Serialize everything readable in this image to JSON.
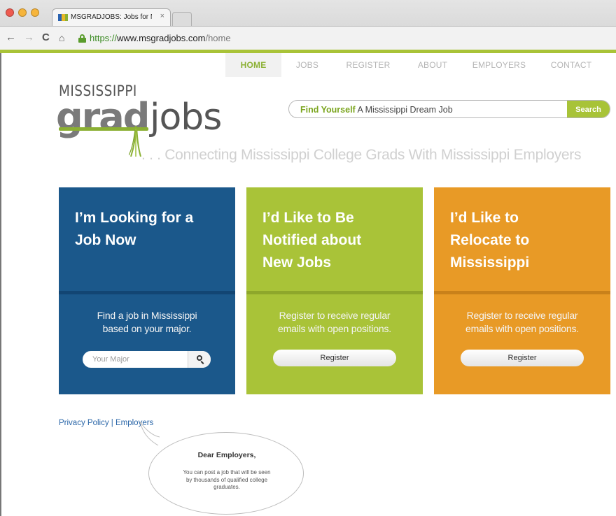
{
  "browser": {
    "tab_title": "MSGRADJOBS: Jobs for Mis",
    "tab_close": "×",
    "url_scheme": "https://",
    "url_host": "www.msgradjobs.com",
    "url_path": "/home",
    "icons": [
      "back-arrow",
      "forward-arrow",
      "reload",
      "home",
      "lock"
    ]
  },
  "nav": {
    "items": [
      {
        "label": "HOME"
      },
      {
        "label": "JOBS"
      },
      {
        "label": "REGISTER"
      },
      {
        "label": "ABOUT"
      },
      {
        "label": "EMPLOYERS"
      },
      {
        "label": "CONTACT"
      }
    ]
  },
  "logo": {
    "top": "MISSISSIPPI",
    "grad": "grad",
    "jobs": "jobs"
  },
  "search": {
    "highlight": "Find Yourself",
    "text": "A Mississippi Dream Job",
    "button": "Search"
  },
  "tagline": ". . . Connecting Mississippi College Grads With Mississippi Employers",
  "cards": [
    {
      "heading": [
        "I’m Looking for a",
        "Job Now"
      ],
      "desc": [
        "Find a job in Mississippi",
        "based on your major."
      ],
      "input_placeholder": "Your Major"
    },
    {
      "heading": [
        "I’d Like to Be",
        "Notified about",
        "New Jobs"
      ],
      "desc": [
        "Register to receive regular",
        "emails with open positions."
      ],
      "button": "Register"
    },
    {
      "heading": [
        "I’d Like to",
        "Relocate to",
        "Mississippi"
      ],
      "desc": [
        "Register to receive regular",
        "emails with open positions."
      ],
      "button": "Register"
    }
  ],
  "footer": {
    "privacy": "Privacy Policy",
    "sep": "|",
    "employers": "Employers"
  },
  "bubble": {
    "title": "Dear Employers,",
    "lines": [
      "You can post a job that will be seen",
      "by thousands of qualified college",
      "graduates."
    ]
  },
  "colors": {
    "accent_green": "#a9c338",
    "blue": "#1b588b",
    "orange": "#e89a26"
  }
}
